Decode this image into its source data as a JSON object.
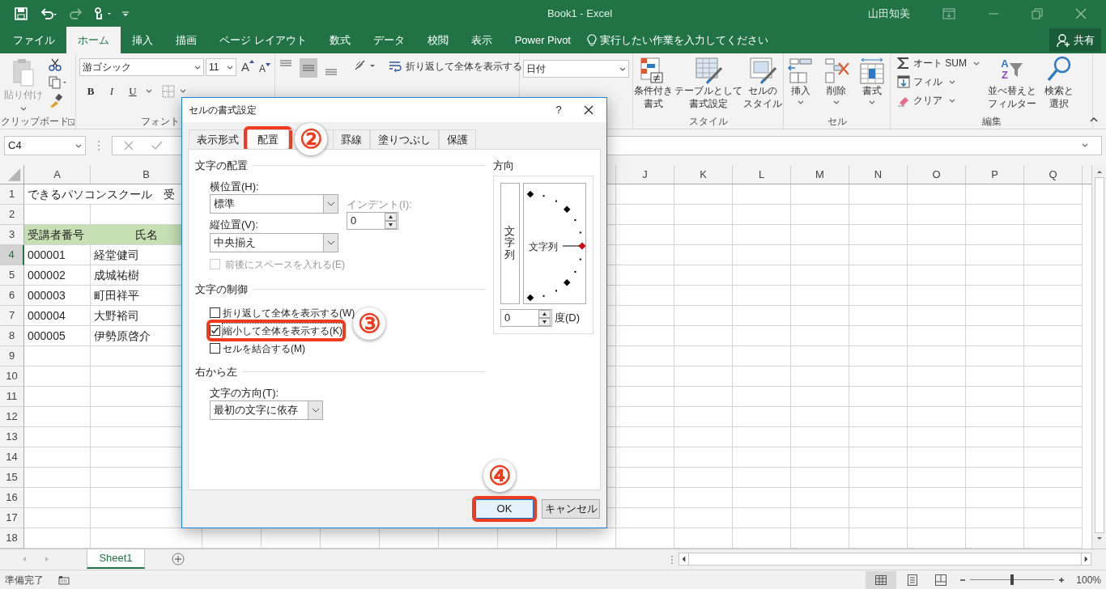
{
  "title_bar": {
    "title": "Book1 - Excel",
    "user": "山田知美"
  },
  "ribbon_tabs": [
    {
      "label": "ファイル",
      "selected": false
    },
    {
      "label": "ホーム",
      "selected": true
    },
    {
      "label": "挿入",
      "selected": false
    },
    {
      "label": "描画",
      "selected": false
    },
    {
      "label": "ページ レイアウト",
      "selected": false
    },
    {
      "label": "数式",
      "selected": false
    },
    {
      "label": "データ",
      "selected": false
    },
    {
      "label": "校閲",
      "selected": false
    },
    {
      "label": "表示",
      "selected": false
    },
    {
      "label": "Power Pivot",
      "selected": false
    }
  ],
  "tell_me": {
    "placeholder": "実行したい作業を入力してください"
  },
  "share_button": "共有",
  "ribbon": {
    "clipboard": {
      "paste": "貼り付け",
      "label": "クリップボード"
    },
    "font": {
      "font_name": "游ゴシック",
      "font_size": "11",
      "size_buttons": [
        "A",
        "A"
      ],
      "format_buttons": [
        "B",
        "I",
        "U"
      ],
      "label": "フォント"
    },
    "alignment": {
      "wrap_text": "折り返して全体を表示する"
    },
    "number": {
      "format": "日付"
    },
    "styles": {
      "buttons": [
        {
          "lines": [
            "条件付き",
            "書式"
          ]
        },
        {
          "lines": [
            "テーブルとして",
            "書式設定"
          ]
        },
        {
          "lines": [
            "セルの",
            "スタイル"
          ]
        }
      ],
      "label": "スタイル"
    },
    "cells": {
      "buttons": [
        {
          "lines": [
            "挿入"
          ]
        },
        {
          "lines": [
            "削除"
          ]
        },
        {
          "lines": [
            "書式"
          ]
        }
      ],
      "label": "セル"
    },
    "editing": {
      "autosum": "オート SUM",
      "fill": "フィル",
      "clear": "クリア",
      "sort_letters": [
        "A",
        "Z"
      ],
      "sort": [
        "並べ替えと",
        "フィルター"
      ],
      "find": [
        "検索と",
        "選択"
      ],
      "label": "編集"
    }
  },
  "formula_bar": {
    "name_box": "C4"
  },
  "sheet": {
    "columns": [
      "A",
      "B",
      "J",
      "K",
      "L",
      "M",
      "N",
      "O",
      "P",
      "Q"
    ],
    "rows": [
      {
        "number": "1",
        "selected": false,
        "kind": "title",
        "cells": [
          "できるパソコンスクール　受"
        ]
      },
      {
        "number": "2",
        "selected": false,
        "kind": "empty",
        "cells": []
      },
      {
        "number": "3",
        "selected": false,
        "kind": "header",
        "cells": [
          "受講者番号",
          "氏名"
        ]
      },
      {
        "number": "4",
        "selected": true,
        "kind": "data",
        "cells": [
          "000001",
          "経堂健司"
        ]
      },
      {
        "number": "5",
        "selected": false,
        "kind": "data",
        "cells": [
          "000002",
          "成城祐樹"
        ]
      },
      {
        "number": "6",
        "selected": false,
        "kind": "data",
        "cells": [
          "000003",
          "町田祥平"
        ]
      },
      {
        "number": "7",
        "selected": false,
        "kind": "data",
        "cells": [
          "000004",
          "大野裕司"
        ]
      },
      {
        "number": "8",
        "selected": false,
        "kind": "data",
        "cells": [
          "000005",
          "伊勢原啓介"
        ]
      },
      {
        "number": "9",
        "selected": false,
        "kind": "empty",
        "cells": []
      },
      {
        "number": "10",
        "selected": false,
        "kind": "empty",
        "cells": []
      },
      {
        "number": "11",
        "selected": false,
        "kind": "empty",
        "cells": []
      },
      {
        "number": "12",
        "selected": false,
        "kind": "empty",
        "cells": []
      },
      {
        "number": "13",
        "selected": false,
        "kind": "empty",
        "cells": []
      },
      {
        "number": "14",
        "selected": false,
        "kind": "empty",
        "cells": []
      },
      {
        "number": "15",
        "selected": false,
        "kind": "empty",
        "cells": []
      },
      {
        "number": "16",
        "selected": false,
        "kind": "empty",
        "cells": []
      },
      {
        "number": "17",
        "selected": false,
        "kind": "empty",
        "cells": []
      },
      {
        "number": "18",
        "selected": false,
        "kind": "empty",
        "cells": []
      }
    ]
  },
  "sheet_tabs": [
    {
      "label": "Sheet1",
      "selected": true
    }
  ],
  "status_bar": {
    "status": "準備完了",
    "zoom": "100%",
    "zoom_level": {
      "level": 0.5
    }
  },
  "dialog": {
    "title": "セルの書式設定",
    "help": "?",
    "tabs": [
      {
        "label": "表示形式",
        "selected": false,
        "highlighted": false
      },
      {
        "label": "配置",
        "selected": true,
        "highlighted": true
      },
      {
        "label": "罫線",
        "selected": false,
        "highlighted": false
      },
      {
        "label": "塗りつぶし",
        "selected": false,
        "highlighted": false
      },
      {
        "label": "保護",
        "selected": false,
        "highlighted": false
      }
    ],
    "text_alignment": {
      "heading": "文字の配置",
      "horizontal_label": "横位置(H):",
      "horizontal_value": "標準",
      "indent": {
        "label": "インデント(I):",
        "value": "0",
        "disabled": true
      },
      "vertical_label": "縦位置(V):",
      "vertical_value": "中央揃え",
      "distributed": {
        "label": "前後にスペースを入れる(E)",
        "checked": false,
        "disabled": true
      }
    },
    "text_control": {
      "heading": "文字の制御",
      "options": [
        {
          "label": "折り返して全体を表示する(W)",
          "checked": false,
          "highlighted": false
        },
        {
          "label": "縮小して全体を表示する(K)",
          "checked": true,
          "highlighted": true
        },
        {
          "label": "セルを結合する(M)",
          "checked": false,
          "highlighted": false
        }
      ]
    },
    "right_to_left": {
      "heading": "右から左",
      "direction_label": "文字の方向(T):",
      "direction_value": "最初の文字に依存"
    },
    "orientation": {
      "heading": "方向",
      "vertical_text": "文字列",
      "dial_text": "文字列",
      "degrees_value": "0",
      "degrees_label": "度(D)"
    },
    "buttons": [
      {
        "label": "OK",
        "kind": "default",
        "highlighted": true
      },
      {
        "label": "キャンセル",
        "kind": "normal",
        "highlighted": false
      }
    ]
  },
  "step_markers": [
    "②",
    "③",
    "④"
  ]
}
